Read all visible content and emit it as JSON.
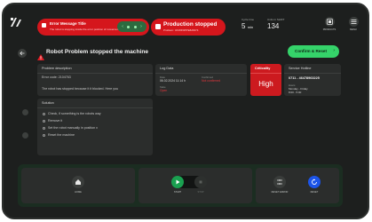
{
  "topbar": {
    "error": {
      "title": "Error Message Title",
      "subtitle": "The robot is stopping inside the error position of movement"
    },
    "production": {
      "title": "Production stopped",
      "subtitle": "Problem: UFW4W5TE8AW74"
    },
    "cycle_time": {
      "label": "Cycle time",
      "value": "5",
      "unit": "min"
    },
    "units_shift": {
      "label": "Units in SHIFT",
      "value": "134"
    },
    "products_label": "PRODUCTS",
    "menu_label": "MENU"
  },
  "page": {
    "title": "Robot Problem stopped the machine",
    "confirm_label": "Confirm & Reset"
  },
  "problem": {
    "heading": "Problem description",
    "code": "Error code: 2104763",
    "description": "The robot has stopped because it it blocked. Here you"
  },
  "log": {
    "heading": "Log Data",
    "date_label": "Date",
    "date_value": "06.02.2024  11:14 h",
    "confirmed_label": "Confirmed",
    "confirmed_value": "Not confirmed",
    "state_label": "State",
    "state_value": "Open"
  },
  "criticality": {
    "heading": "Criticality",
    "value": "High"
  },
  "service": {
    "heading": "Service Hotline",
    "phone": "0711 - 46478963225",
    "hours_label": "Hours",
    "days": "Monday - Friday",
    "time": "8:00 - 5:00"
  },
  "solution": {
    "heading": "Solution",
    "steps": [
      "Check, if something is the robots way",
      "Remove it",
      "Set the robot manually in position x",
      "Reset the machine"
    ]
  },
  "controls": {
    "home_label": "HOME",
    "start_label": "START",
    "stop_label": "STOP",
    "reset_label": "RESET ERROR",
    "deselect_label": "RESET"
  },
  "colors": {
    "alert_red": "#d5161c",
    "confirm_green": "#35d36a",
    "play_green": "#1aa050",
    "reset_blue": "#1c54e8",
    "panel_bg": "#1d1f1e"
  }
}
